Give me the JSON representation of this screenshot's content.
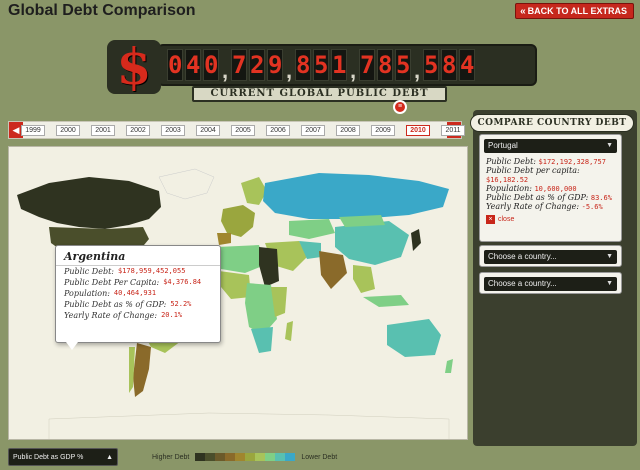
{
  "header": {
    "title": "Global Debt Comparison",
    "back_label": "BACK TO ALL EXTRAS"
  },
  "counter": {
    "symbol": "$",
    "digits": [
      "0",
      "4",
      "0",
      ",",
      "7",
      "2",
      "9",
      ",",
      "8",
      "5",
      "1",
      ",",
      "7",
      "8",
      "5",
      ",",
      "5",
      "8",
      "4"
    ],
    "label": "CURRENT GLOBAL PUBLIC DEBT"
  },
  "timeline": {
    "years": [
      "1999",
      "2000",
      "2001",
      "2002",
      "2003",
      "2004",
      "2005",
      "2006",
      "2007",
      "2008",
      "2009",
      "2010",
      "2011"
    ],
    "selected": "2010",
    "prev": "◀",
    "next": "▶"
  },
  "popup": {
    "country": "Argentina",
    "rows": [
      {
        "label": "Public Debt:",
        "value": "$178,959,452,055"
      },
      {
        "label": "Public Debt Per Capita:",
        "value": "$4,376.84"
      },
      {
        "label": "Population:",
        "value": "40,464,931"
      },
      {
        "label": "Public Debt as % of GDP:",
        "value": "52.2%"
      },
      {
        "label": "Yearly Rate of Change:",
        "value": "20.1%"
      }
    ]
  },
  "compare": {
    "title": "COMPARE COUNTRY DEBT",
    "slot1": {
      "country": "Portugal",
      "rows": [
        {
          "label": "Public Debt:",
          "value": "$172,192,328,757"
        },
        {
          "label": "Public Debt per capita:",
          "value": "$16,182.52"
        },
        {
          "label": "Population:",
          "value": "10,600,000"
        },
        {
          "label": "Public Debt as % of GDP:",
          "value": "83.6%"
        },
        {
          "label": "Yearly Rate of Change:",
          "value": "-5.6%"
        }
      ],
      "close_label": "close"
    },
    "slot2": {
      "placeholder": "Choose a country..."
    },
    "slot3": {
      "placeholder": "Choose a country..."
    }
  },
  "legend": {
    "selector": "Public Debt as GDP %",
    "higher": "Higher Debt",
    "lower": "Lower Debt",
    "colors": [
      "#2f3320",
      "#4a4e2b",
      "#6b5a2a",
      "#8a6a2a",
      "#a0862e",
      "#9aa63e",
      "#a8c35a",
      "#7fcf86",
      "#59c0b0",
      "#3aa8c8"
    ]
  },
  "colors": {
    "accent": "#c8261a",
    "map_bg": "#f2f0e3"
  }
}
